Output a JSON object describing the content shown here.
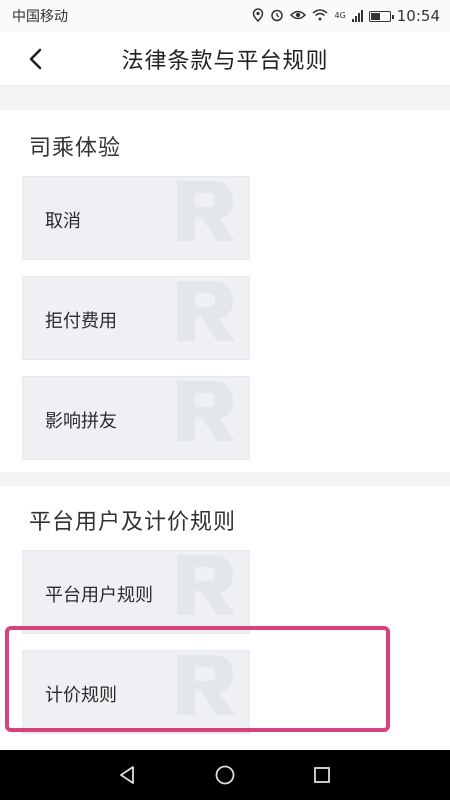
{
  "status_bar": {
    "carrier": "中国移动",
    "time": "10:54",
    "network": "4G",
    "icons": [
      "location-icon",
      "alarm-icon",
      "eye-icon",
      "wifi-icon",
      "signal-icon",
      "battery-icon"
    ]
  },
  "header": {
    "title": "法律条款与平台规则",
    "back_icon": "chevron-left-icon"
  },
  "sections": [
    {
      "title": "司乘体验",
      "items": [
        {
          "label": "取消"
        },
        {
          "label": "拒付费用"
        },
        {
          "label": "影响拼友"
        }
      ]
    },
    {
      "title": "平台用户及计价规则",
      "items": [
        {
          "label": "平台用户规则"
        },
        {
          "label": "计价规则",
          "highlighted": true
        }
      ]
    }
  ],
  "highlight_color": "#d8417a",
  "system_nav": {
    "icons": [
      "back-triangle-icon",
      "home-circle-icon",
      "recents-square-icon"
    ]
  }
}
